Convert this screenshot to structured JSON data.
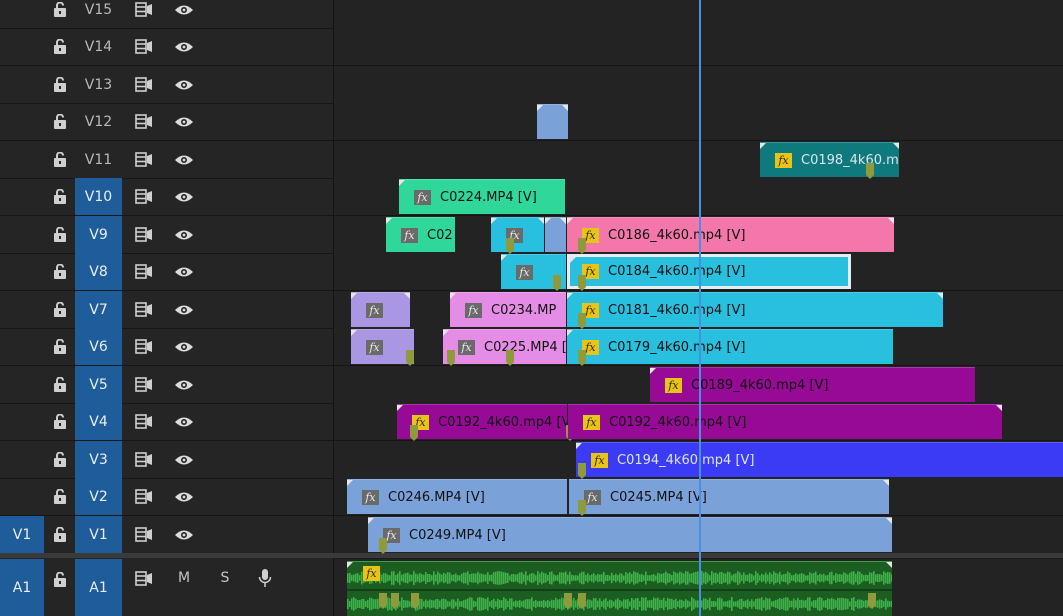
{
  "video_tracks": [
    {
      "name": "V15",
      "source": "",
      "targeted": false
    },
    {
      "name": "V14",
      "source": "",
      "targeted": false
    },
    {
      "name": "V13",
      "source": "",
      "targeted": false
    },
    {
      "name": "V12",
      "source": "",
      "targeted": false
    },
    {
      "name": "V11",
      "source": "",
      "targeted": false
    },
    {
      "name": "V10",
      "source": "",
      "targeted": true
    },
    {
      "name": "V9",
      "source": "",
      "targeted": true
    },
    {
      "name": "V8",
      "source": "",
      "targeted": true
    },
    {
      "name": "V7",
      "source": "",
      "targeted": true
    },
    {
      "name": "V6",
      "source": "",
      "targeted": true
    },
    {
      "name": "V5",
      "source": "",
      "targeted": true
    },
    {
      "name": "V4",
      "source": "",
      "targeted": true
    },
    {
      "name": "V3",
      "source": "",
      "targeted": true
    },
    {
      "name": "V2",
      "source": "",
      "targeted": true
    },
    {
      "name": "V1",
      "source": "V1",
      "targeted": true
    }
  ],
  "audio_tracks": [
    {
      "name": "A1",
      "source": "A1",
      "targeted": true,
      "mute": "M",
      "solo": "S"
    }
  ],
  "clips": {
    "c_v12": {
      "name": "",
      "fx": ""
    },
    "c_v11": {
      "name": "C0198_4k60.m",
      "fx": "fx"
    },
    "c_v10": {
      "name": "C0224.MP4 [V]",
      "fx": "fx"
    },
    "c_v9a": {
      "name": "C02",
      "fx": "fx"
    },
    "c_v9b": {
      "name": "",
      "fx": "fx"
    },
    "c_v9c": {
      "name": "",
      "fx": ""
    },
    "c_v9d": {
      "name": "C0186_4k60.mp4 [V]",
      "fx": "fx"
    },
    "c_v8a": {
      "name": "",
      "fx": "fx"
    },
    "c_v8b": {
      "name": "C0184_4k60.mp4 [V]",
      "fx": "fx"
    },
    "c_v7a": {
      "name": "",
      "fx": "fx"
    },
    "c_v7b": {
      "name": "C0234.MP",
      "fx": "fx"
    },
    "c_v7c": {
      "name": "C0181_4k60.mp4 [V]",
      "fx": "fx"
    },
    "c_v6a": {
      "name": "",
      "fx": "fx"
    },
    "c_v6b": {
      "name": "C0225.MP4 [",
      "fx": "fx"
    },
    "c_v6c": {
      "name": "C0179_4k60.mp4 [V]",
      "fx": "fx"
    },
    "c_v5": {
      "name": "C0189_4k60.mp4 [V]",
      "fx": "fx"
    },
    "c_v4a": {
      "name": "C0192_4k60.mp4 [V",
      "fx": "fx"
    },
    "c_v4b": {
      "name": "C0192_4k60.mp4 [V]",
      "fx": "fx"
    },
    "c_v3": {
      "name": "C0194_4k60.mp4 [V]",
      "fx": "fx"
    },
    "c_v2a": {
      "name": "C0246.MP4 [V]",
      "fx": "fx"
    },
    "c_v2b": {
      "name": "C0245.MP4 [V]",
      "fx": "fx"
    },
    "c_v1": {
      "name": "C0249.MP4 [V]",
      "fx": "fx"
    },
    "c_a1": {
      "name": "",
      "fx": "fx"
    }
  },
  "colors": {
    "teal": "#0e7a7e",
    "mint": "#2fd89a",
    "steel_blue": "#7aa1d8",
    "pink": "#f477aa",
    "cyan": "#29bfdf",
    "lavender": "#a997e3",
    "orchid": "#e58de6",
    "purple": "#960a96",
    "violet_blue": "#3b3bf5",
    "audio_green": "#1c5d22",
    "playhead": "#4a90e2",
    "track_target": "#1e5d99"
  },
  "icons": {
    "lock": "lock-open-icon",
    "sync": "sync-lock-icon",
    "eye": "eye-icon",
    "mic": "microphone-icon",
    "fx": "fx-badge-icon"
  }
}
